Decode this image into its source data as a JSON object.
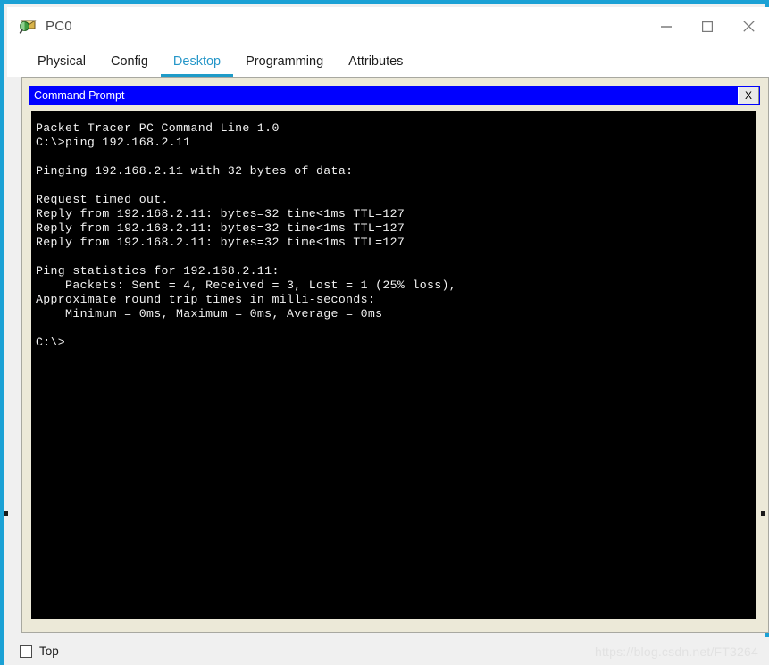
{
  "window": {
    "title": "PC0",
    "icon": "packet-tracer-pc-icon",
    "controls": {
      "minimize": "minimize-icon",
      "maximize": "maximize-icon",
      "close": "close-icon"
    },
    "accent_color": "#1ba1d5"
  },
  "tabs": [
    {
      "label": "Physical",
      "active": false
    },
    {
      "label": "Config",
      "active": false
    },
    {
      "label": "Desktop",
      "active": true
    },
    {
      "label": "Programming",
      "active": false
    },
    {
      "label": "Attributes",
      "active": false
    }
  ],
  "tab_active_color": "#2596c8",
  "command_prompt": {
    "title": "Command Prompt",
    "titlebar_color": "#0000ff",
    "close_label": "X",
    "terminal_background": "#000000",
    "terminal_foreground": "#f2f2f2",
    "lines": [
      "Packet Tracer PC Command Line 1.0",
      "C:\\>ping 192.168.2.11",
      "",
      "Pinging 192.168.2.11 with 32 bytes of data:",
      "",
      "Request timed out.",
      "Reply from 192.168.2.11: bytes=32 time<1ms TTL=127",
      "Reply from 192.168.2.11: bytes=32 time<1ms TTL=127",
      "Reply from 192.168.2.11: bytes=32 time<1ms TTL=127",
      "",
      "Ping statistics for 192.168.2.11:",
      "    Packets: Sent = 4, Received = 3, Lost = 1 (25% loss),",
      "Approximate round trip times in milli-seconds:",
      "    Minimum = 0ms, Maximum = 0ms, Average = 0ms",
      "",
      "C:\\>"
    ]
  },
  "bottom": {
    "top_checkbox_label": "Top",
    "top_checkbox_checked": false
  },
  "watermark": "https://blog.csdn.net/FT3264"
}
